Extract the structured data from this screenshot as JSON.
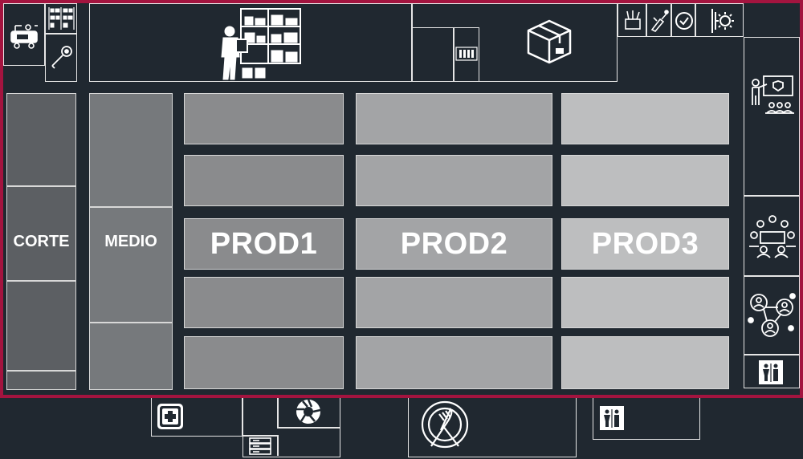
{
  "zones": {
    "corte": {
      "label": "CORTE",
      "color": "#5c5f63"
    },
    "medio": {
      "label": "MEDIO",
      "color": "#76797c"
    },
    "prod1": {
      "label": "PROD1",
      "color": "#8a8b8d"
    },
    "prod2": {
      "label": "PROD2",
      "color": "#a3a4a6"
    },
    "prod3": {
      "label": "PROD3",
      "color": "#bdbebf"
    }
  },
  "colors": {
    "background": "#202830",
    "frame": "#a3143f",
    "lines": "#e6e6e6"
  },
  "icons": [
    "compressor-icon",
    "shelving-icon",
    "wrench-icon",
    "warehouse-worker-icon",
    "loading-dock-icon",
    "package-box-icon",
    "tools-icon",
    "paint-sprayer-icon",
    "check-circle-icon",
    "gear-icon",
    "training-icon",
    "meeting-icon",
    "network-people-icon",
    "restroom-icon",
    "first-aid-icon",
    "camera-shutter-icon",
    "server-icon",
    "dining-icon"
  ]
}
